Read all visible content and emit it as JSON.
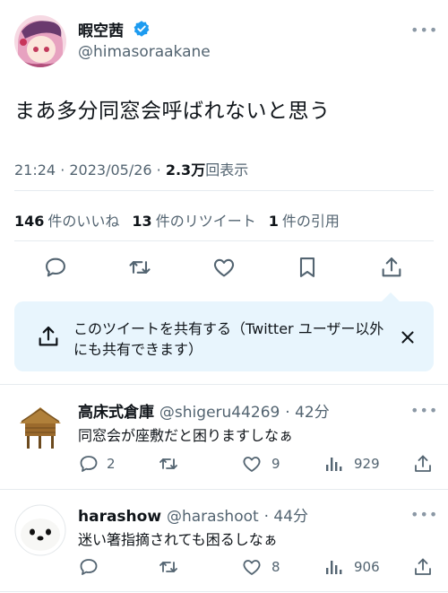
{
  "tweet": {
    "author_name": "暇空茜",
    "author_handle": "@himasoraakane",
    "text": "まあ多分同窓会呼ばれないと思う",
    "time": "21:24 · 2023/05/26 · ",
    "views_count": "2.3万",
    "views_label": "回表示",
    "likes_count": "146",
    "likes_label": "件のいいね",
    "retweets_count": "13",
    "retweets_label": "件のリツイート",
    "quotes_count": "1",
    "quotes_label": "件の引用",
    "more_icon": "more-icon"
  },
  "share_callout": {
    "text": "このツイートを共有する（Twitter ユーザー以外にも共有できます）"
  },
  "replies": [
    {
      "name": "高床式倉庫",
      "handle": "@shigeru44269",
      "time": "· 42分",
      "text": "同窓会が座敷だと困りますしなぁ",
      "replies": "2",
      "likes": "9",
      "views": "929"
    },
    {
      "name": "harashow",
      "handle": "@harashoot",
      "time": "· 44分",
      "text": "迷い箸指摘されても困るしなぁ",
      "replies": "",
      "likes": "8",
      "views": "906"
    }
  ],
  "colors": {
    "text": "#0f1419",
    "secondary": "#536471",
    "verified": "#1d9bf0",
    "callout_bg": "#e8f5fd"
  }
}
